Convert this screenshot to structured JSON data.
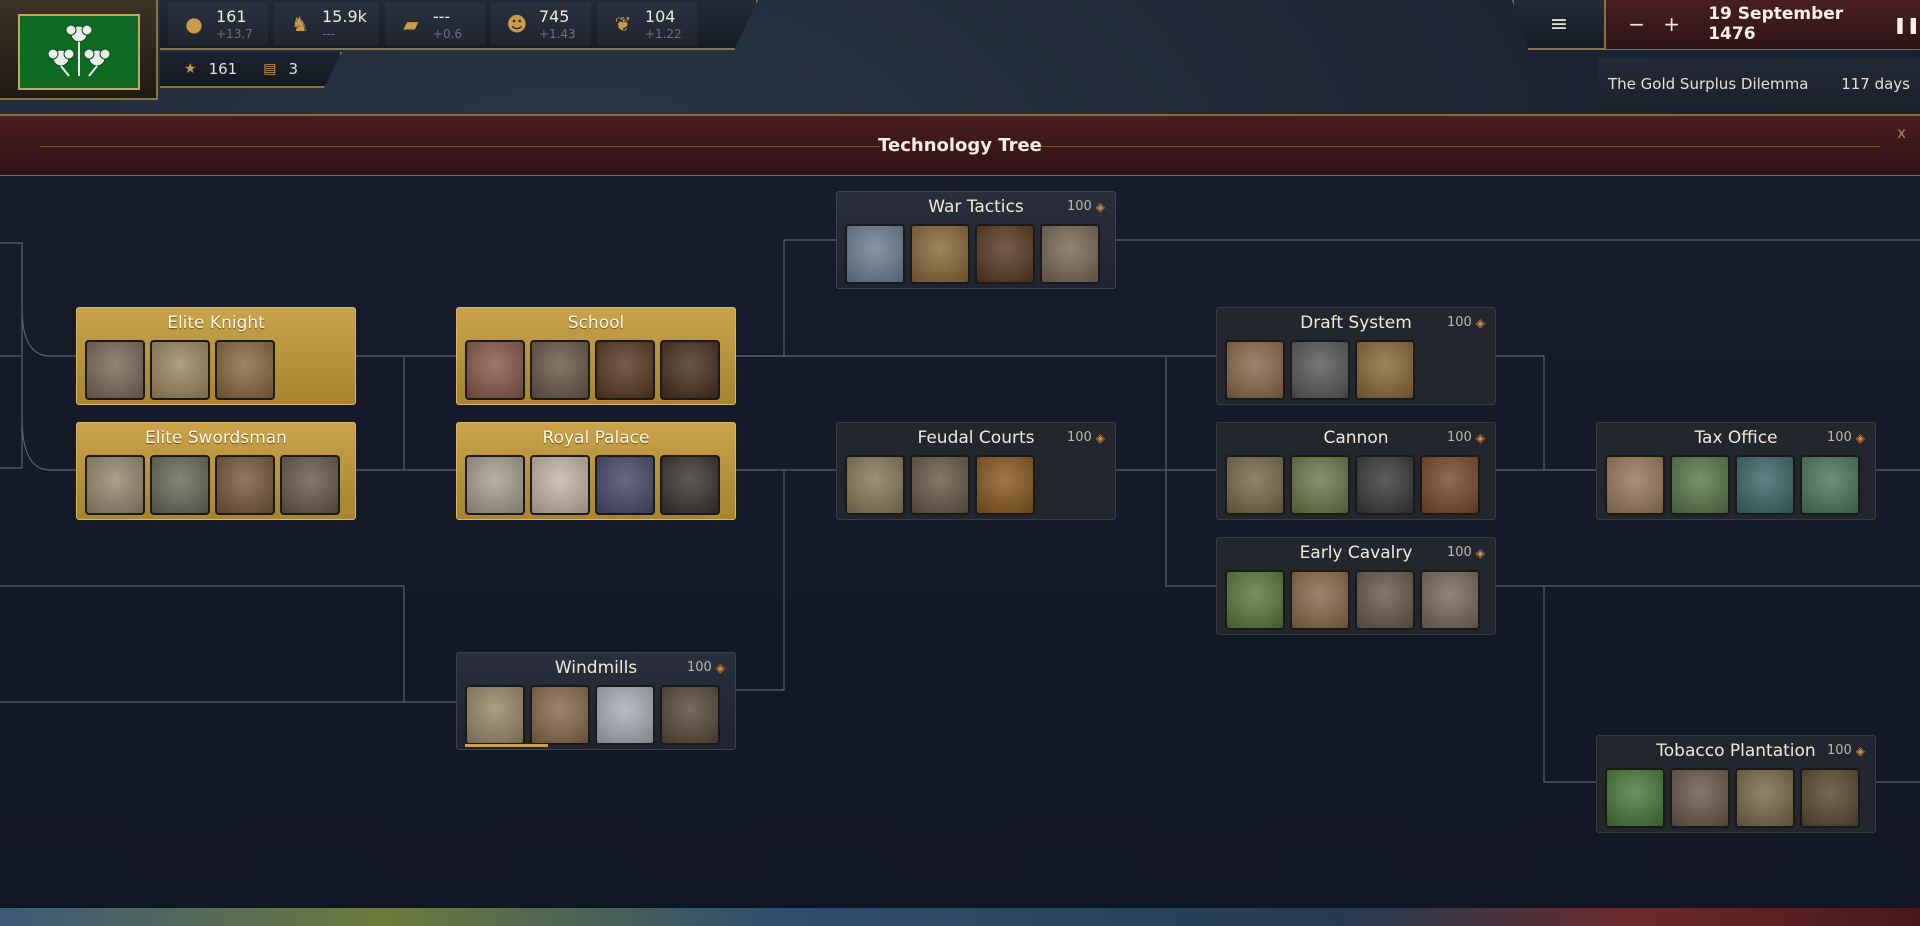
{
  "resources": [
    {
      "icon": "gold-coins-icon",
      "glyph": "●",
      "value": "161",
      "delta": "+13.7"
    },
    {
      "icon": "soldier-icon",
      "glyph": "♞",
      "value": "15.9k",
      "delta": "---"
    },
    {
      "icon": "book-icon",
      "glyph": "▰",
      "value": "---",
      "delta": "+0.6"
    },
    {
      "icon": "bust-icon",
      "glyph": "☻",
      "value": "745",
      "delta": "+1.43"
    },
    {
      "icon": "dove-icon",
      "glyph": "❦",
      "value": "104",
      "delta": "+1.22"
    }
  ],
  "subbar": {
    "star_value": "161",
    "scroll_value": "3"
  },
  "top_right": {
    "date": "19 September 1476",
    "minus": "−",
    "plus": "+",
    "pause": "❚❚",
    "menu": "≡"
  },
  "event": {
    "title": "The Gold Surplus Dilemma",
    "days": "117 days"
  },
  "panel": {
    "title": "Technology Tree",
    "close": "x"
  },
  "colors": {
    "gold_node": "#c9a24a",
    "dark_node": "#23262c",
    "header": "#4a1d22",
    "flag_green": "#0f6b24"
  },
  "nodes": [
    {
      "id": "war-tactics",
      "title": "War Tactics",
      "cost": "100",
      "state": "avail",
      "imgs": [
        "#6e7f95",
        "#8a6a3a",
        "#5a3a22",
        "#7a6a55"
      ]
    },
    {
      "id": "elite-knight",
      "title": "Elite Knight",
      "cost": "",
      "state": "done",
      "imgs": [
        "#7b6a58",
        "#a08a62",
        "#8a6a40"
      ]
    },
    {
      "id": "school",
      "title": "School",
      "cost": "",
      "state": "done",
      "imgs": [
        "#8a5a4a",
        "#6a5a48",
        "#5a3a22",
        "#4a3020"
      ]
    },
    {
      "id": "draft-system",
      "title": "Draft System",
      "cost": "100",
      "state": "locked",
      "imgs": [
        "#8a6a4a",
        "#5a5a5a",
        "#8a6a3a"
      ]
    },
    {
      "id": "elite-swordsman",
      "title": "Elite Swordsman",
      "cost": "",
      "state": "done",
      "imgs": [
        "#9a8a72",
        "#6a6a5a",
        "#7a5a3a",
        "#6a5a4a"
      ]
    },
    {
      "id": "royal-palace",
      "title": "Royal Palace",
      "cost": "",
      "state": "done",
      "imgs": [
        "#a8a092",
        "#c8b6a8",
        "#4a4a6a",
        "#3a3630"
      ]
    },
    {
      "id": "feudal-courts",
      "title": "Feudal Courts",
      "cost": "100",
      "state": "locked",
      "imgs": [
        "#8a7a5a",
        "#6a5a48",
        "#8a5a20"
      ]
    },
    {
      "id": "cannon",
      "title": "Cannon",
      "cost": "100",
      "state": "locked",
      "imgs": [
        "#7a6a4a",
        "#6a7a4a",
        "#3a3a3a",
        "#7a4a2a"
      ]
    },
    {
      "id": "tax-office",
      "title": "Tax Office",
      "cost": "100",
      "state": "locked",
      "imgs": [
        "#9a7a5a",
        "#5a7a4a",
        "#3a6a6a",
        "#4a7a5a"
      ]
    },
    {
      "id": "early-cavalry",
      "title": "Early Cavalry",
      "cost": "100",
      "state": "locked",
      "imgs": [
        "#5a7a3a",
        "#8a6a4a",
        "#6a5a4a",
        "#7a6a5a"
      ]
    },
    {
      "id": "windmills",
      "title": "Windmills",
      "cost": "100",
      "state": "avail",
      "imgs": [
        "#9a8a6a",
        "#8a6a4a",
        "#a8b0b8",
        "#5a4a3a"
      ],
      "progress": 0.3
    },
    {
      "id": "tobacco-plantation",
      "title": "Tobacco Plantation",
      "cost": "100",
      "state": "locked",
      "imgs": [
        "#4a7a3a",
        "#6a5a4a",
        "#7a6a4a",
        "#5a4a30"
      ]
    }
  ]
}
